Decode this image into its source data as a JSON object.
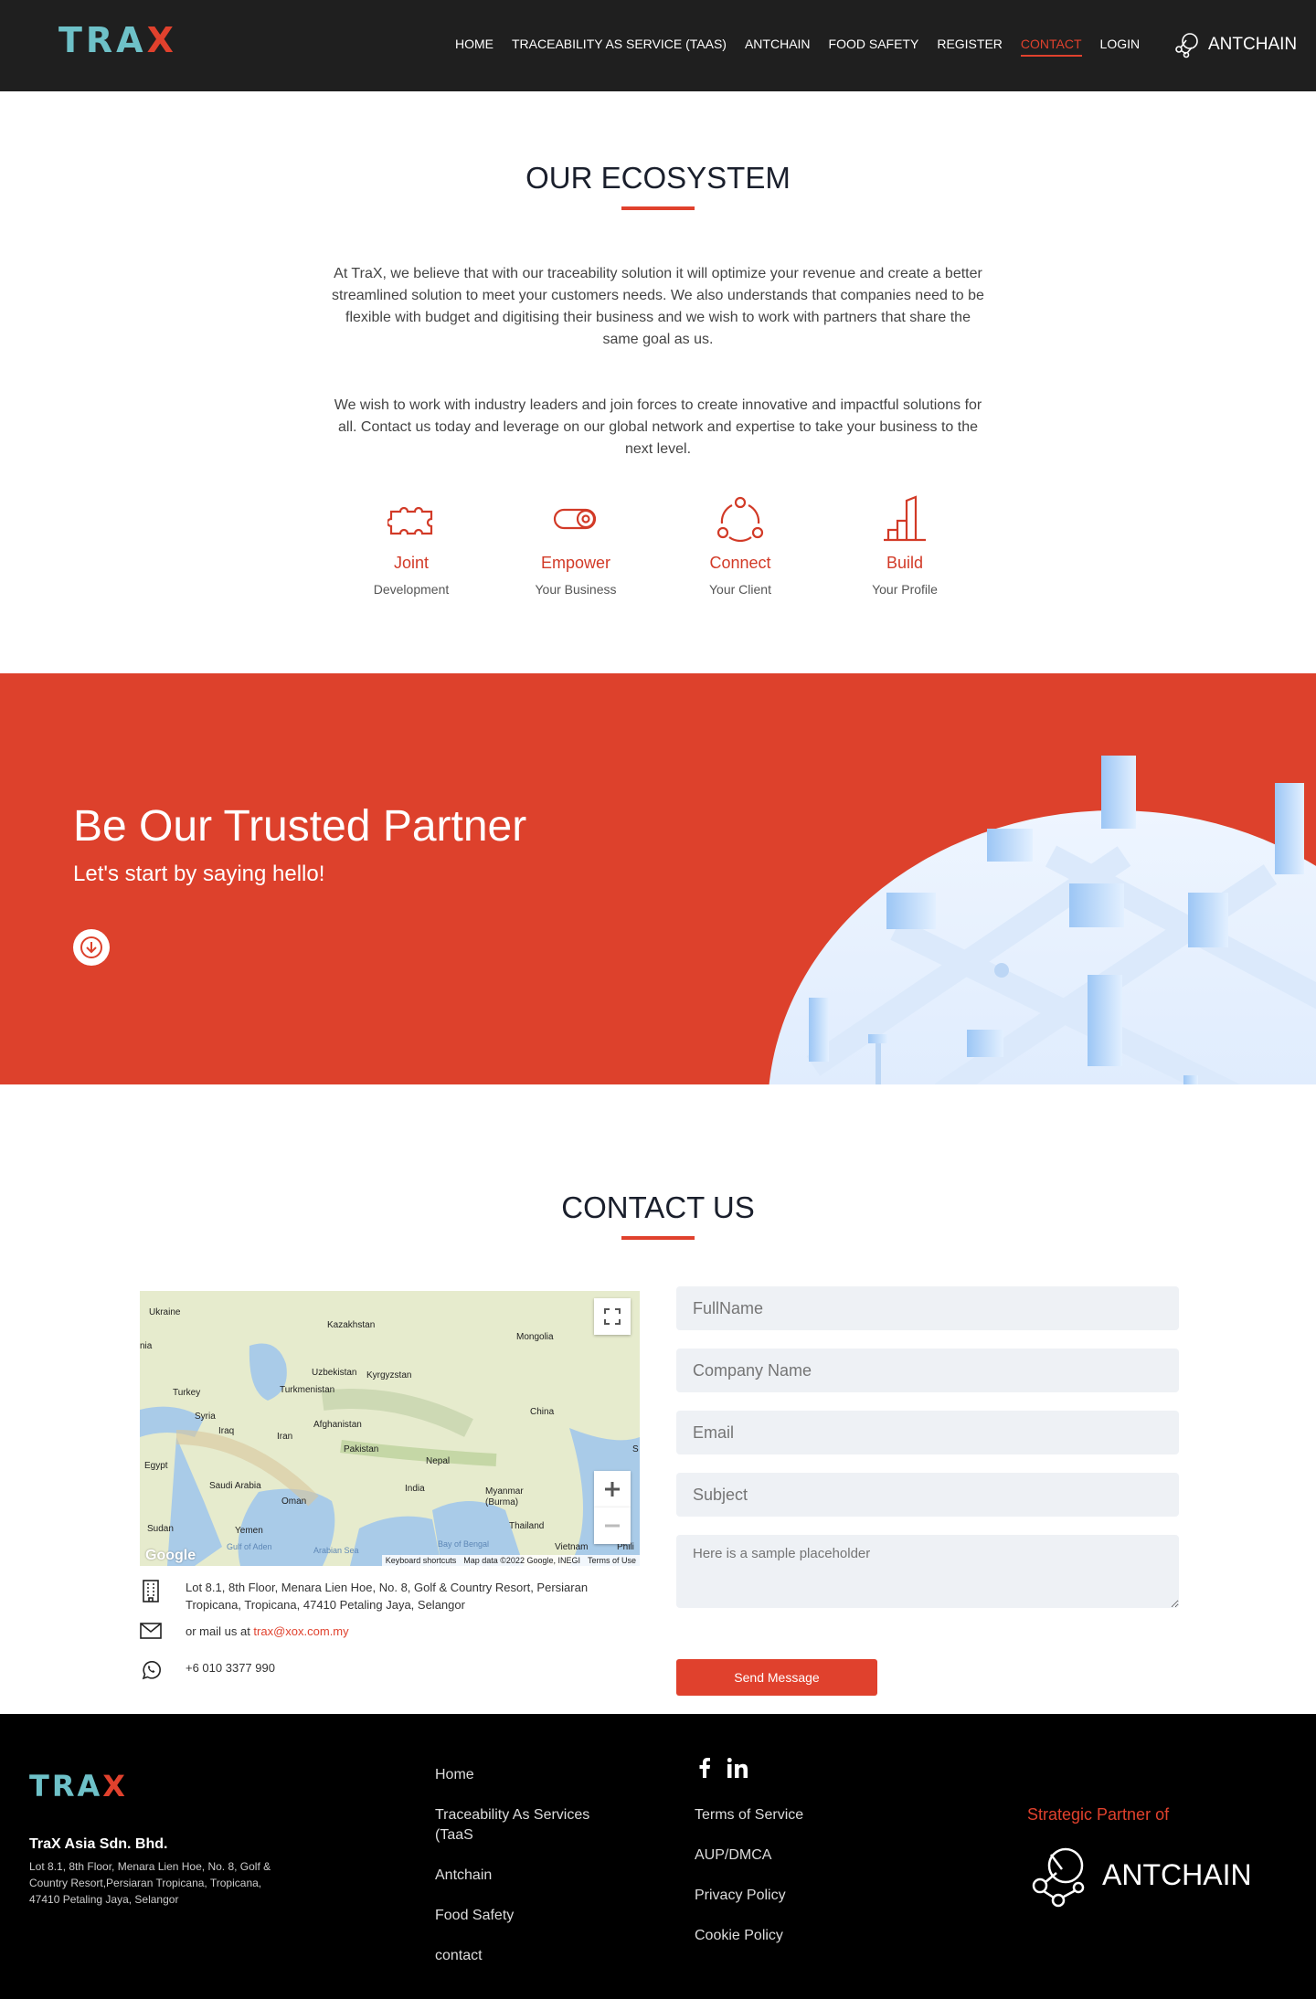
{
  "nav": {
    "logo_left": "TRA",
    "logo_right": "X",
    "links": [
      {
        "label": "HOME"
      },
      {
        "label": "TRACEABILITY AS SERVICE (TAAS)"
      },
      {
        "label": "ANTCHAIN"
      },
      {
        "label": "FOOD SAFETY"
      },
      {
        "label": "REGISTER"
      },
      {
        "label": "CONTACT"
      },
      {
        "label": "LOGIN"
      }
    ],
    "active_link": "CONTACT",
    "partner": "ANTCHAIN"
  },
  "ecosystem": {
    "title": "OUR ECOSYSTEM",
    "para1": "At TraX, we believe that with our traceability solution it will optimize your revenue and create a better streamlined solution to meet your customers needs. We also understands that companies need to be flexible with budget and digitising their business and we wish to work with partners that share the same goal as us.",
    "para2": "We wish to work with industry leaders and join forces to create innovative and impactful solutions for all. Contact us today and leverage on our global network and expertise to take your business to the next level.",
    "features": [
      {
        "title": "Joint",
        "sub": "Development",
        "icon": "puzzle-icon"
      },
      {
        "title": "Empower",
        "sub": "Your Business",
        "icon": "toggle-icon"
      },
      {
        "title": "Connect",
        "sub": "Your Client",
        "icon": "network-icon"
      },
      {
        "title": "Build",
        "sub": "Your Profile",
        "icon": "growth-icon"
      }
    ]
  },
  "hero": {
    "title": "Be Our Trusted Partner",
    "subtitle": "Let's start by saying hello!",
    "button_icon": "arrow-down-icon"
  },
  "contact": {
    "title": "CONTACT US",
    "map": {
      "labels": [
        "Ukraine",
        "Kazakhstan",
        "Mongolia",
        "Uzbekistan",
        "Kyrgyzstan",
        "Turkey",
        "Turkmenistan",
        "Syria",
        "Iraq",
        "Iran",
        "Afghanistan",
        "China",
        "Pakistan",
        "Nepal",
        "Egypt",
        "Saudi Arabia",
        "India",
        "Oman",
        "Myanmar (Burma)",
        "Sudan",
        "Yemen",
        "Thailand",
        "Gulf of Aden",
        "Arabian Sea",
        "Bay of Bengal",
        "Vietnam",
        "Phili",
        "nia",
        "S"
      ],
      "attribution": [
        "Keyboard shortcuts",
        "Map data ©2022 Google, INEGI",
        "Terms of Use"
      ],
      "brand": "Google"
    },
    "address": "Lot 8.1, 8th Floor, Menara Lien Hoe, No. 8, Golf & Country Resort, Persiaran Tropicana, Tropicana, 47410 Petaling Jaya, Selangor",
    "mail_prefix": "or mail us at ",
    "email": "trax@xox.com.my",
    "phone": "+6 010 3377 990",
    "form": {
      "fullname_placeholder": "FullName",
      "company_placeholder": "Company Name",
      "email_placeholder": "Email",
      "subject_placeholder": "Subject",
      "message_placeholder": "Here is a sample placeholder",
      "submit_label": "Send Message"
    }
  },
  "footer": {
    "logo_left": "TRA",
    "logo_right": "X",
    "company": "TraX Asia Sdn. Bhd.",
    "address": "Lot 8.1, 8th Floor, Menara Lien Hoe, No. 8, Golf & Country Resort,Persiaran Tropicana, Tropicana, 47410 Petaling Jaya, Selangor",
    "col1": [
      "Home",
      "Traceability As Services (TaaS",
      "Antchain",
      "Food Safety",
      "contact"
    ],
    "social": [
      "facebook-icon",
      "linkedin-icon"
    ],
    "col2": [
      "Terms of Service",
      "AUP/DMCA",
      "Privacy Policy",
      "Cookie Policy"
    ],
    "strategic": "Strategic Partner of",
    "partner": "ANTCHAIN"
  }
}
